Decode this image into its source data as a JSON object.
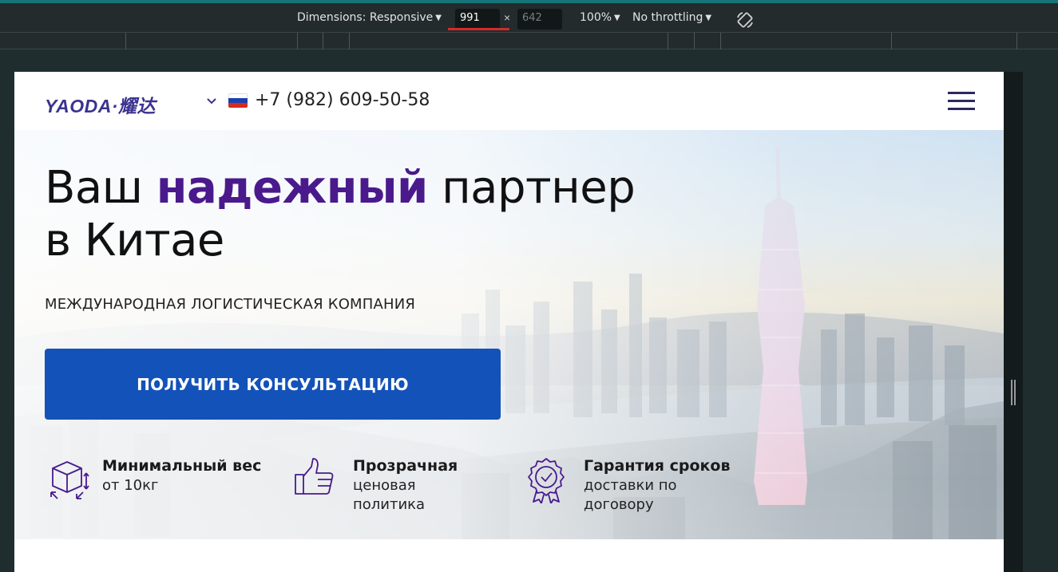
{
  "devtools": {
    "dimensions_label": "Dimensions: Responsive",
    "width_value": "991",
    "height_value": "642",
    "times": "×",
    "zoom": "100%",
    "throttling": "No throttling",
    "dropdown_arrow": "▼"
  },
  "site": {
    "logo": "YAODA·耀达",
    "phone": "+7 (982) 609-50-58",
    "flag_colors": [
      "#ffffff",
      "#1c3fb0",
      "#d52b1e"
    ],
    "accent_color": "#4a1a8c",
    "cta_color": "#1352b9"
  },
  "hero": {
    "title_part1": "Ваш ",
    "title_accent": "надежный",
    "title_part2": " партнер в Китае",
    "subtitle": "МЕЖДУНАРОДНАЯ ЛОГИСТИЧЕСКАЯ КОМПАНИЯ",
    "cta_label": "ПОЛУЧИТЬ КОНСУЛЬТАЦИЮ"
  },
  "features": [
    {
      "icon": "box-icon",
      "title": "Минимальный вес",
      "text": "от 10кг"
    },
    {
      "icon": "thumbs-up-icon",
      "title": "Прозрачная",
      "text": "ценовая политика"
    },
    {
      "icon": "badge-check-icon",
      "title": "Гарантия сроков",
      "text": "доставки по договору"
    }
  ]
}
